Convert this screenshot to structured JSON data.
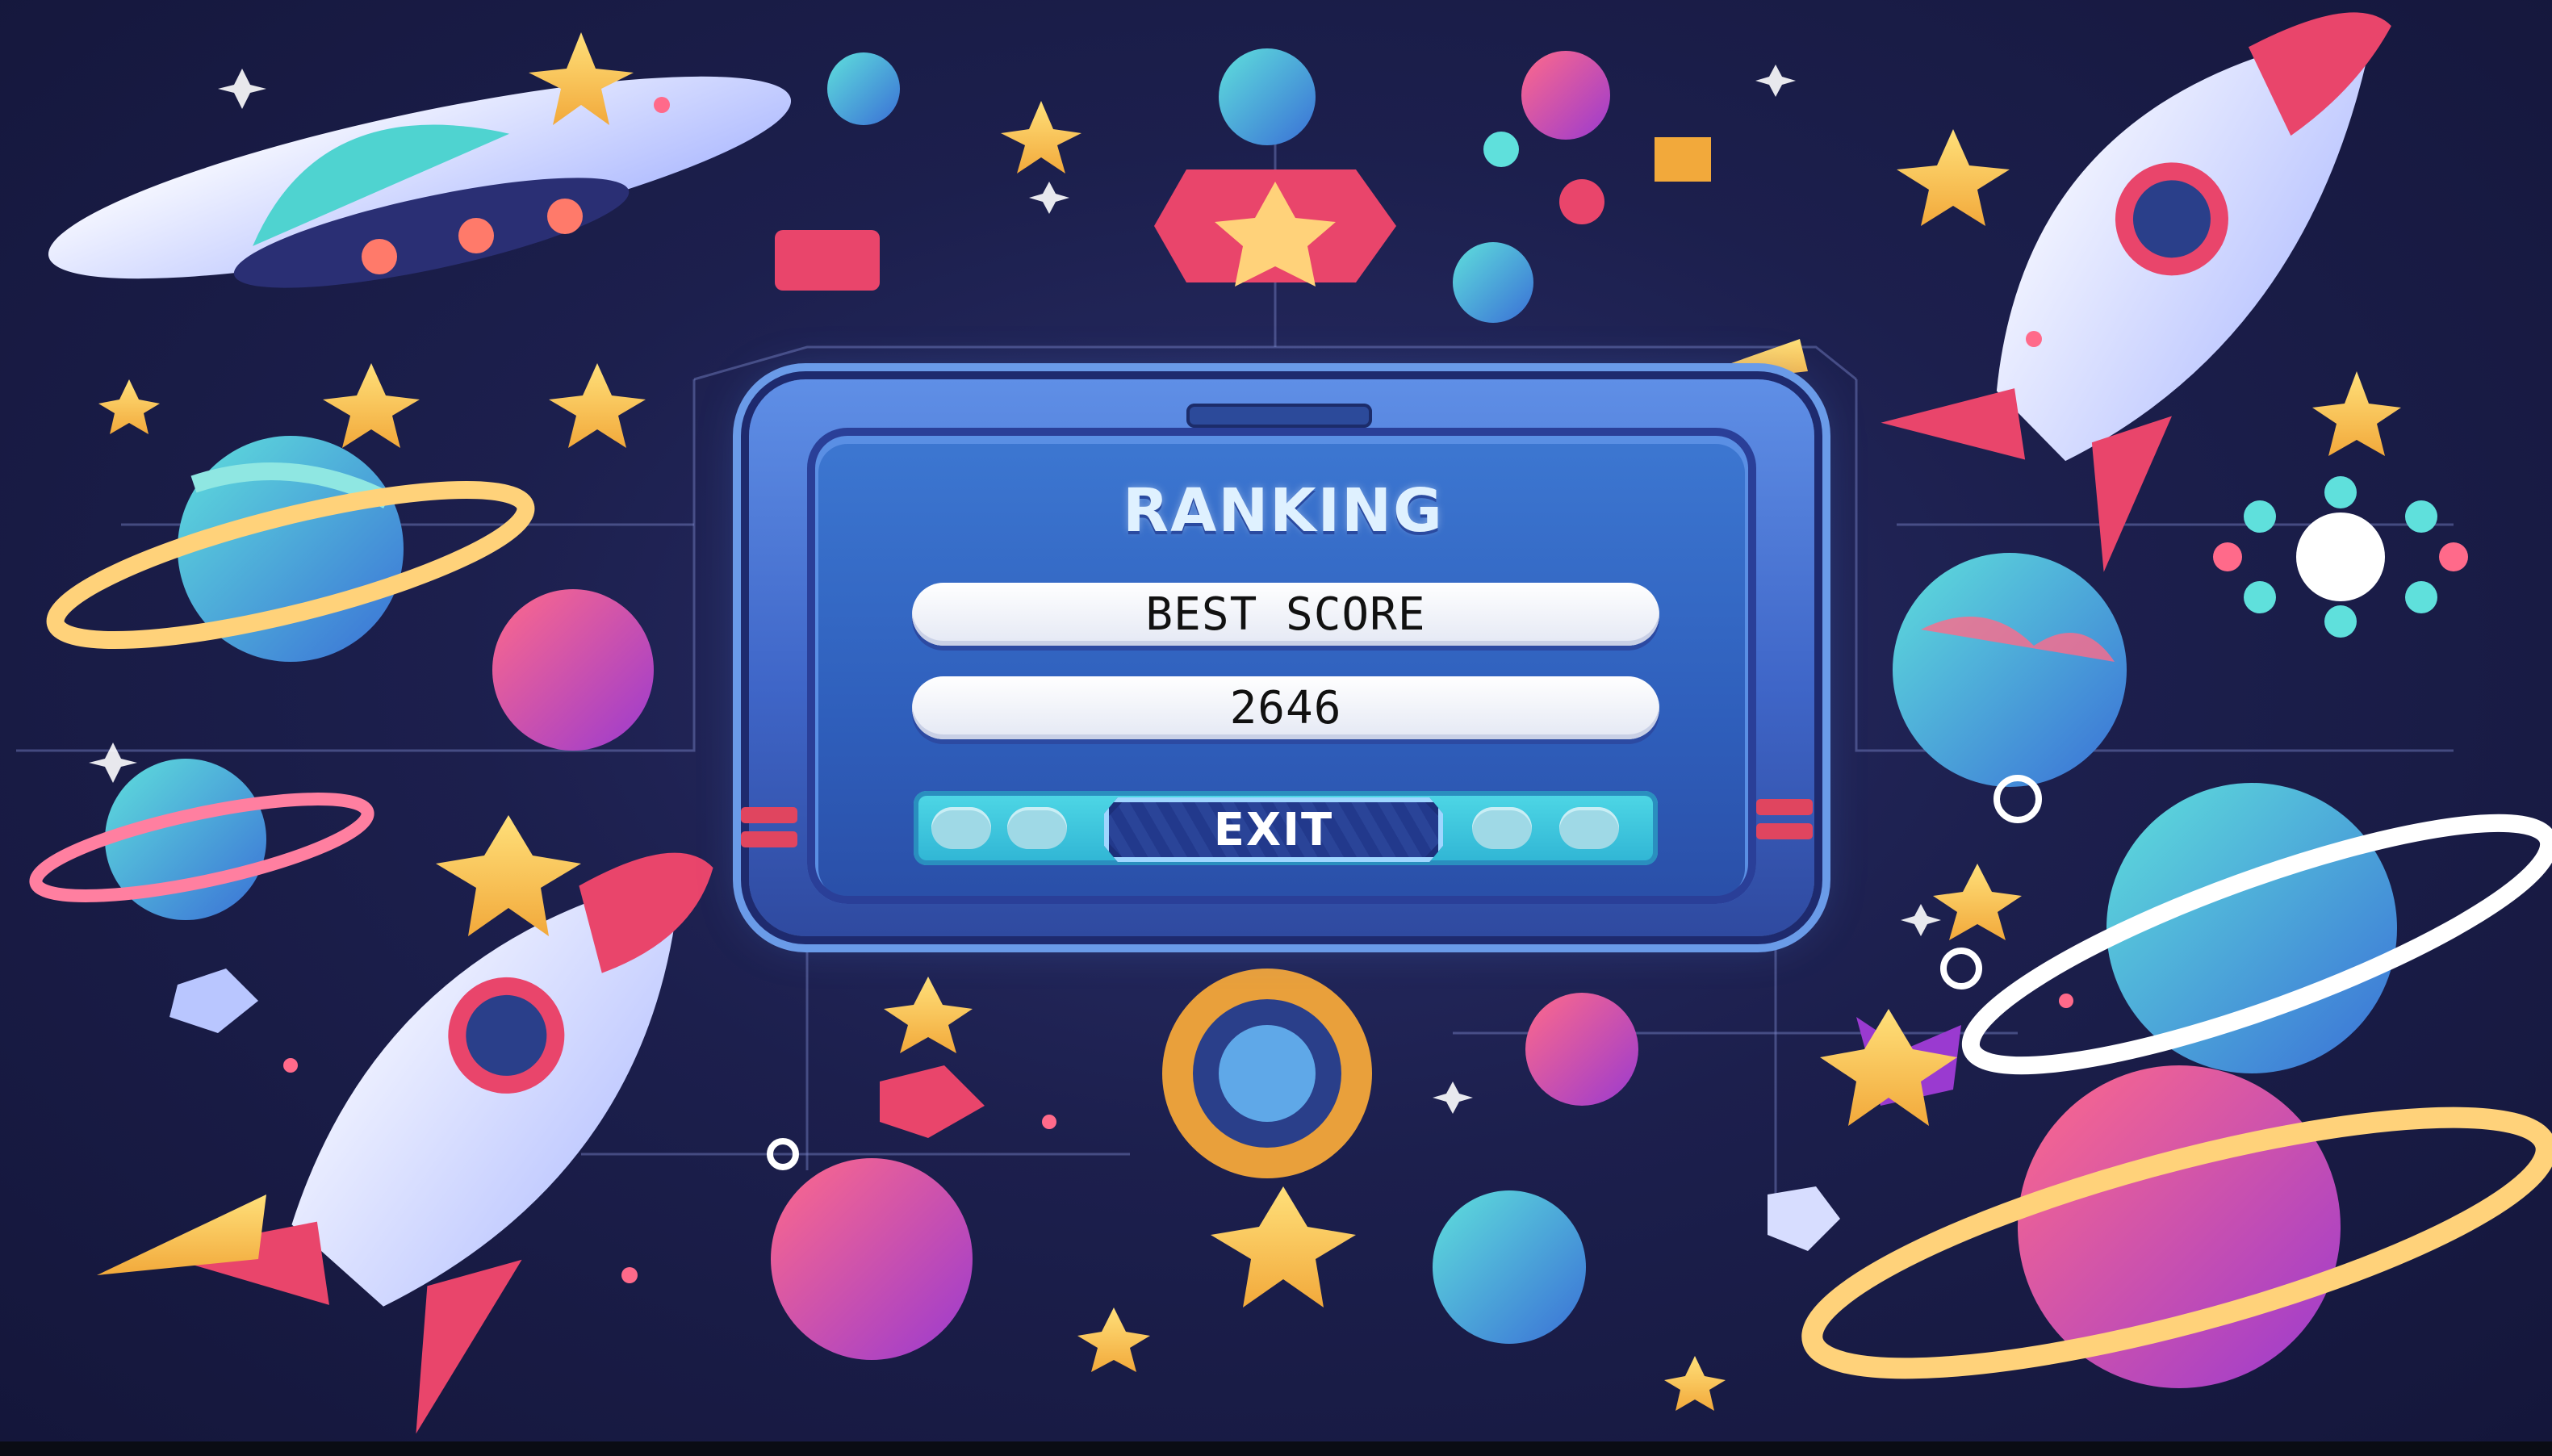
{
  "panel": {
    "title": "RANKING",
    "best_score_label": "BEST SCORE",
    "best_score_value": "2646",
    "exit_label": "EXIT"
  },
  "colors": {
    "background": "#1c1f4d",
    "panel_blue": "#3d78d2",
    "accent_cyan": "#4fd8e6",
    "accent_pink": "#e0455f",
    "accent_yellow": "#f7c64a"
  },
  "decor": {
    "icons": [
      "ufo-icon",
      "rocket-icon",
      "planet-icon",
      "ringed-planet-icon",
      "star-icon",
      "gem-icon",
      "badge-icon"
    ]
  }
}
